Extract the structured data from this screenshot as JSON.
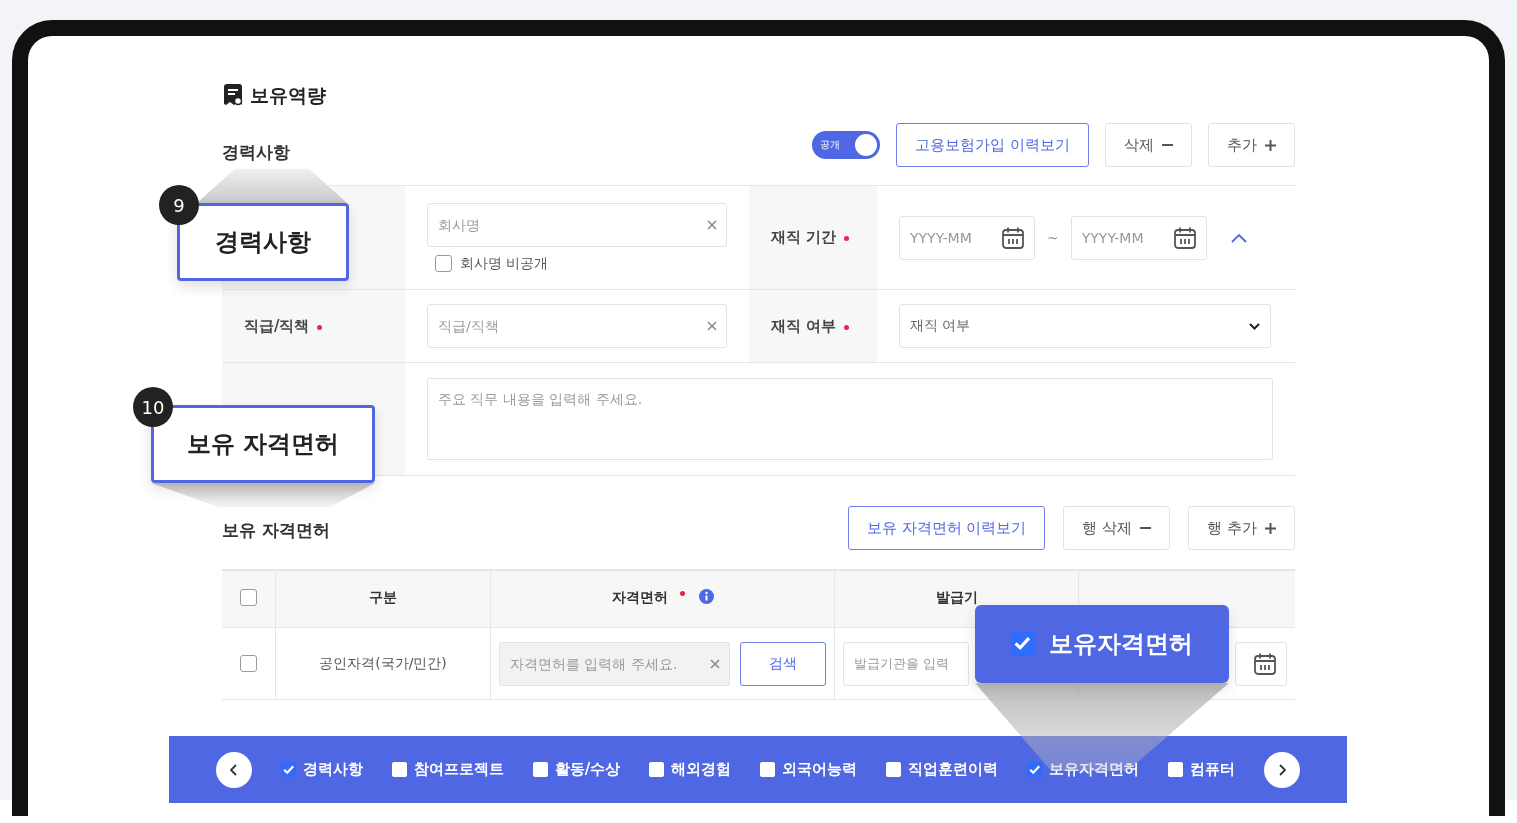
{
  "heading": {
    "title": "보유역량"
  },
  "career": {
    "title": "경력사항",
    "public_toggle": {
      "label": "공개",
      "on": true
    },
    "buttons": [
      {
        "label": "고용보험가입 이력보기",
        "kind": "outline"
      },
      {
        "label": "삭제",
        "kind": "minus"
      },
      {
        "label": "추가",
        "kind": "plus"
      }
    ],
    "company": {
      "placeholder": "회사명",
      "hide_label": "회사명 비공개",
      "hide_checked": false
    },
    "period": {
      "label": "재직 기간",
      "required": true,
      "start_placeholder": "YYYY-MM",
      "separator": "~",
      "end_placeholder": "YYYY-MM",
      "expanded": true
    },
    "position": {
      "label": "직급/직책",
      "required": true,
      "placeholder": "직급/직책"
    },
    "status": {
      "label": "재직 여부",
      "required": true,
      "value": "재직 여부"
    },
    "duties": {
      "placeholder": "주요 직무 내용을 입력해 주세요."
    }
  },
  "licenses": {
    "title": "보유 자격면허",
    "buttons": [
      {
        "label": "보유 자격면허 이력보기",
        "kind": "outline"
      },
      {
        "label": "행 삭제",
        "kind": "minus"
      },
      {
        "label": "행 추가",
        "kind": "plus"
      }
    ],
    "select_all_checked": false,
    "columns": [
      {
        "label": "구분",
        "required": false
      },
      {
        "label": "자격면허",
        "required": true
      },
      {
        "label": "발급기",
        "required": false
      }
    ],
    "rows": [
      {
        "checked": false,
        "category": "공인자격(국가/민간)",
        "license_placeholder": "자격면허를 입력해 주세요.",
        "search_label": "검색",
        "issuer_placeholder": "발급기관을 입력"
      }
    ]
  },
  "tab_bar": {
    "items": [
      {
        "label": "경력사항",
        "checked": true
      },
      {
        "label": "참여프로젝트",
        "checked": false
      },
      {
        "label": "활동/수상",
        "checked": false
      },
      {
        "label": "해외경험",
        "checked": false
      },
      {
        "label": "외국어능력",
        "checked": false
      },
      {
        "label": "직업훈련이력",
        "checked": false
      },
      {
        "label": "보유자격면허",
        "checked": true
      },
      {
        "label": "컴퓨터",
        "checked": false
      }
    ]
  },
  "callouts": [
    {
      "kind": "numbered",
      "number": "9",
      "label": "경력사항"
    },
    {
      "kind": "numbered",
      "number": "10",
      "label": "보유 자격면허"
    },
    {
      "kind": "checked",
      "label": "보유자격면허",
      "checked": true
    }
  ]
}
